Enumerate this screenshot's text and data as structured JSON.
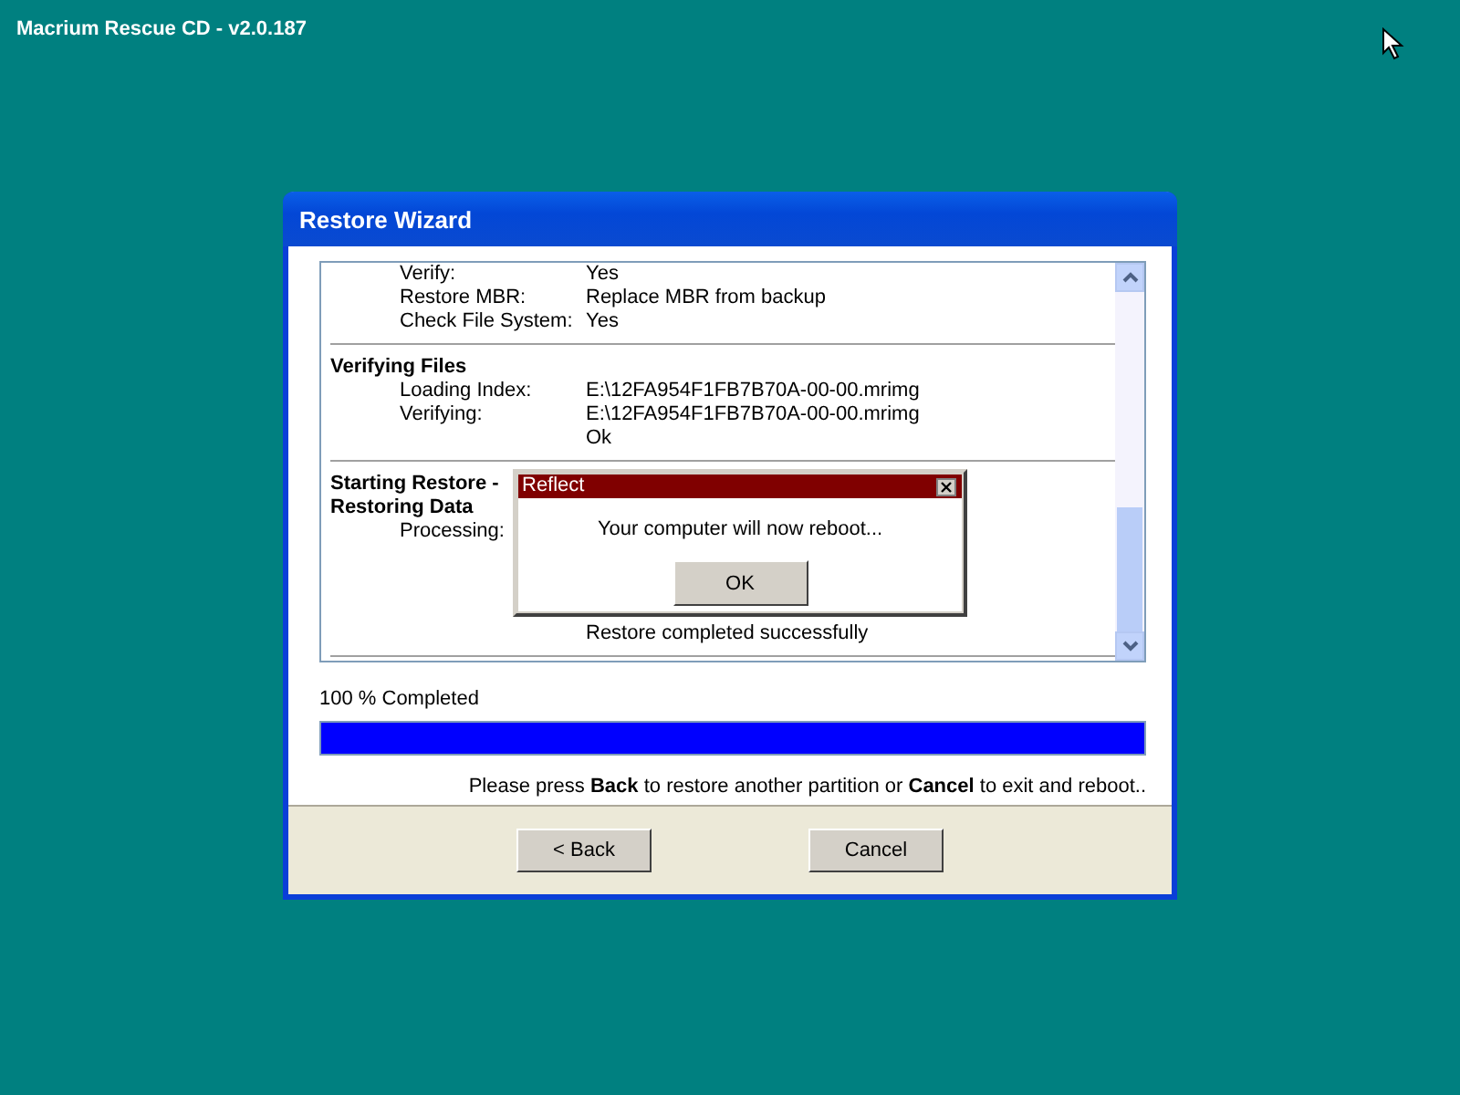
{
  "desktop": {
    "title": "Macrium Rescue CD - v2.0.187"
  },
  "wizard": {
    "title": "Restore Wizard",
    "sections": [
      {
        "rows": [
          {
            "kind": "row",
            "label": "Verify:",
            "value": "Yes"
          },
          {
            "kind": "row",
            "label": "Restore MBR:",
            "value": "Replace MBR from backup"
          },
          {
            "kind": "row",
            "label": "Check File System:",
            "value": "Yes"
          }
        ]
      },
      {
        "headings": [
          "Verifying Files"
        ],
        "rows": [
          {
            "kind": "row",
            "label": "Loading Index:",
            "value": "E:\\12FA954F1FB7B70A-00-00.mrimg"
          },
          {
            "kind": "row",
            "label": "Verifying:",
            "value": "E:\\12FA954F1FB7B70A-00-00.mrimg"
          },
          {
            "kind": "row",
            "value": "Ok"
          }
        ]
      },
      {
        "headings": [
          "Starting Restore -",
          "Restoring Data"
        ],
        "rows": [
          {
            "kind": "row",
            "label": "Processing:"
          },
          {
            "kind": "status",
            "value": "Restore completed successfully"
          }
        ]
      }
    ],
    "progress": {
      "label": "100 % Completed",
      "level": 1
    },
    "instruction": "Please press **Back**  to restore another partition or **Cancel** to exit and reboot..",
    "buttons": [
      "< Back",
      "Cancel"
    ]
  },
  "dialog": {
    "title": "Reflect",
    "message": "Your computer will now reboot...",
    "button": "OK"
  }
}
